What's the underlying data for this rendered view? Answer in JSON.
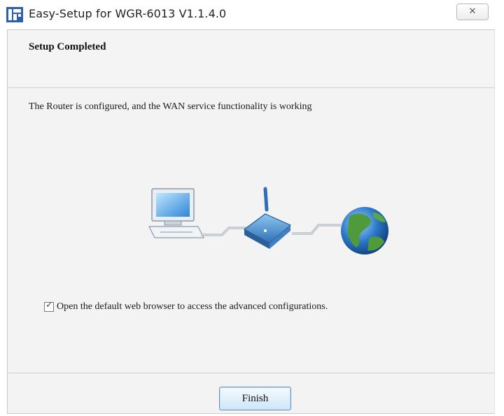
{
  "window": {
    "title": "Easy-Setup for WGR-6013  V1.1.4.0",
    "close_glyph": "✕"
  },
  "header": {
    "title": "Setup Completed"
  },
  "main": {
    "description": "The Router is configured, and the WAN service functionality is working",
    "illustration": {
      "icons": [
        "computer-icon",
        "router-icon",
        "globe-icon"
      ]
    },
    "checkbox": {
      "label": "Open the default web browser to access the advanced configurations.",
      "checked": true
    }
  },
  "footer": {
    "finish_label": "Finish"
  },
  "colors": {
    "accent": "#2f6ea8",
    "button_border": "#6d8fb5"
  }
}
